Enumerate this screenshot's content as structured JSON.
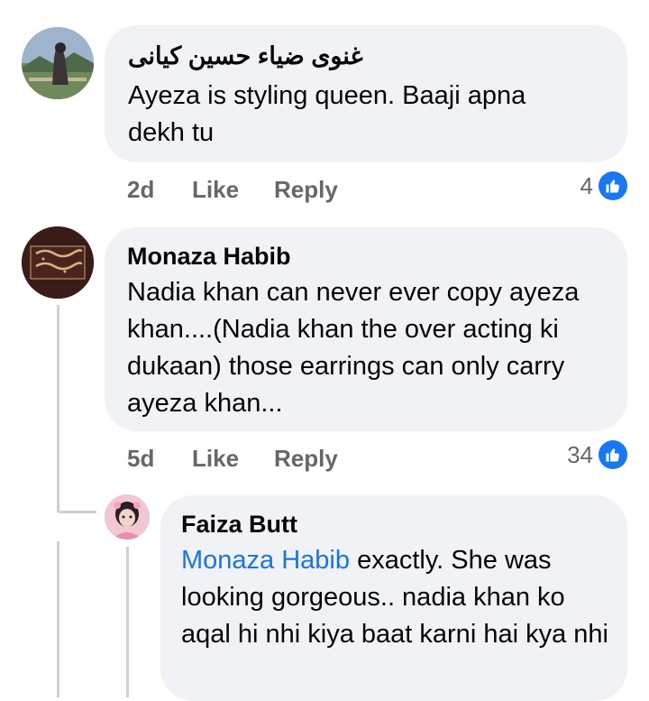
{
  "comments": [
    {
      "author": "غنوی ضیاء حسین کیانی",
      "text": "Ayeza is styling queen. Baaji apna dekh tu",
      "time": "2d",
      "like_label": "Like",
      "reply_label": "Reply",
      "reaction_count": "4"
    },
    {
      "author": "Monaza Habib",
      "text": "Nadia khan can never ever copy ayeza khan....(Nadia khan the over acting ki dukaan) those earrings can only carry ayeza khan...",
      "time": "5d",
      "like_label": "Like",
      "reply_label": "Reply",
      "reaction_count": "34"
    }
  ],
  "reply": {
    "author": "Faiza Butt",
    "mention": "Monaza Habib",
    "text": "exactly. She was looking gorgeous.. nadia khan ko aqal hi nhi kiya baat karni hai kya nhi"
  },
  "colors": {
    "bubble": "#f0f2f5",
    "meta": "#65676b",
    "accent": "#1877f2",
    "mention": "#1b74e4"
  }
}
